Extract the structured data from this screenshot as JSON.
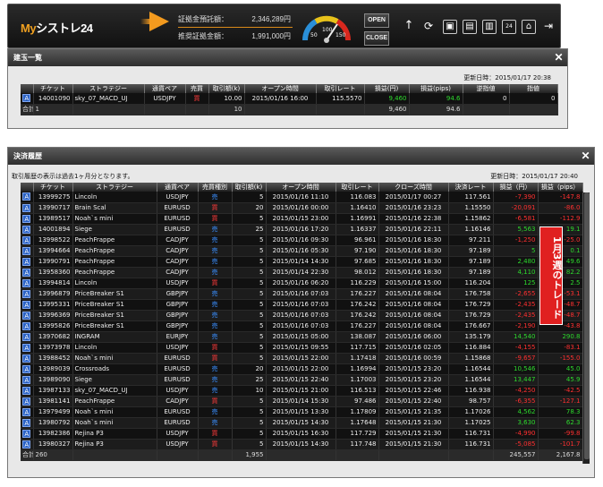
{
  "app": {
    "logo_prefix": "My",
    "logo_name": "シストレ24"
  },
  "account": {
    "margin_label": "証拠金預託額：",
    "margin_value": "2,346,289円",
    "equity_label": "推奨証拠金額：",
    "equity_value": "1,991,000円"
  },
  "gauge": {
    "ticks": [
      "50",
      "100",
      "150"
    ]
  },
  "toolbar": {
    "open_label": "OPEN",
    "close_label": "CLOSE"
  },
  "positions": {
    "title": "建玉一覧",
    "updated": "更新日時：2015/01/17 20:38",
    "headers": [
      "チケット",
      "ストラテジー",
      "通貨ペア",
      "売買",
      "取引額(k)",
      "オープン時間",
      "取引レート",
      "損益(円)",
      "損益(pips)",
      "逆指値",
      "指値"
    ],
    "rows": [
      {
        "icon": "A",
        "ticket": "14001090",
        "strategy": "sky_07_MACD_UJ",
        "pair": "USDJPY",
        "side": "買",
        "amount": "10.00",
        "open": "2015/01/16 16:00",
        "rate": "115.5570",
        "pnl": "9,460",
        "pips": "94.6",
        "stop": "0",
        "limit": "0"
      }
    ],
    "total": {
      "label": "合計",
      "count": "1",
      "amount": "10",
      "pnl": "9,460",
      "pips": "94.6"
    }
  },
  "history": {
    "title": "決済履歴",
    "note": "取引履歴の表示は過去1ヶ月分となります。",
    "updated": "更新日時：2015/01/17 20:40",
    "headers": [
      "チケット",
      "ストラテジー",
      "通貨ペア",
      "売買種別",
      "取引額(k)",
      "オープン時間",
      "取引レート",
      "クローズ時間",
      "決済レート",
      "損益（円）",
      "損益（pips）"
    ],
    "rows": [
      {
        "ticket": "13999275",
        "strategy": "Lincoln",
        "pair": "USDJPY",
        "side": "売",
        "amount": "5",
        "open": "2015/01/16 11:10",
        "rate": "116.083",
        "close": "2015/01/17 00:27",
        "crate": "117.561",
        "pnl": "-7,390",
        "pips": "-147.8"
      },
      {
        "ticket": "13990717",
        "strategy": "Brain Scal",
        "pair": "EURUSD",
        "side": "買",
        "amount": "20",
        "open": "2015/01/16 00:00",
        "rate": "1.16410",
        "close": "2015/01/16 23:23",
        "crate": "1.15550",
        "pnl": "-20,091",
        "pips": "-86.0"
      },
      {
        "ticket": "13989517",
        "strategy": "Noah`s mini",
        "pair": "EURUSD",
        "side": "買",
        "amount": "5",
        "open": "2015/01/15 23:00",
        "rate": "1.16991",
        "close": "2015/01/16 22:38",
        "crate": "1.15862",
        "pnl": "-6,581",
        "pips": "-112.9"
      },
      {
        "ticket": "14001894",
        "strategy": "Siege",
        "pair": "EURUSD",
        "side": "売",
        "amount": "25",
        "open": "2015/01/16 17:20",
        "rate": "1.16337",
        "close": "2015/01/16 22:11",
        "crate": "1.16146",
        "pnl": "5,563",
        "pips": "19.1"
      },
      {
        "ticket": "13998522",
        "strategy": "PeachFrappe",
        "pair": "CADJPY",
        "side": "売",
        "amount": "5",
        "open": "2015/01/16 09:30",
        "rate": "96.961",
        "close": "2015/01/16 18:30",
        "crate": "97.211",
        "pnl": "-1,250",
        "pips": "-25.0"
      },
      {
        "ticket": "13994664",
        "strategy": "PeachFrappe",
        "pair": "CADJPY",
        "side": "売",
        "amount": "5",
        "open": "2015/01/16 05:30",
        "rate": "97.190",
        "close": "2015/01/16 18:30",
        "crate": "97.189",
        "pnl": "5",
        "pips": "0.1"
      },
      {
        "ticket": "13990791",
        "strategy": "PeachFrappe",
        "pair": "CADJPY",
        "side": "売",
        "amount": "5",
        "open": "2015/01/14 14:30",
        "rate": "97.685",
        "close": "2015/01/16 18:30",
        "crate": "97.189",
        "pnl": "2,480",
        "pips": "49.6"
      },
      {
        "ticket": "13958360",
        "strategy": "PeachFrappe",
        "pair": "CADJPY",
        "side": "売",
        "amount": "5",
        "open": "2015/01/14 22:30",
        "rate": "98.012",
        "close": "2015/01/16 18:30",
        "crate": "97.189",
        "pnl": "4,110",
        "pips": "82.2"
      },
      {
        "ticket": "13994814",
        "strategy": "Lincoln",
        "pair": "USDJPY",
        "side": "買",
        "amount": "5",
        "open": "2015/01/16 06:20",
        "rate": "116.229",
        "close": "2015/01/16 15:00",
        "crate": "116.204",
        "pnl": "125",
        "pips": "2.5"
      },
      {
        "ticket": "13996879",
        "strategy": "PriceBreaker S1",
        "pair": "GBPJPY",
        "side": "売",
        "amount": "5",
        "open": "2015/01/16 07:03",
        "rate": "176.227",
        "close": "2015/01/16 08:04",
        "crate": "176.758",
        "pnl": "-2,655",
        "pips": "-53.1"
      },
      {
        "ticket": "13995331",
        "strategy": "PriceBreaker S1",
        "pair": "GBPJPY",
        "side": "売",
        "amount": "5",
        "open": "2015/01/16 07:03",
        "rate": "176.242",
        "close": "2015/01/16 08:04",
        "crate": "176.729",
        "pnl": "-2,435",
        "pips": "-48.7"
      },
      {
        "ticket": "13996369",
        "strategy": "PriceBreaker S1",
        "pair": "GBPJPY",
        "side": "売",
        "amount": "5",
        "open": "2015/01/16 07:03",
        "rate": "176.242",
        "close": "2015/01/16 08:04",
        "crate": "176.729",
        "pnl": "-2,435",
        "pips": "-48.7"
      },
      {
        "ticket": "13995826",
        "strategy": "PriceBreaker S1",
        "pair": "GBPJPY",
        "side": "売",
        "amount": "5",
        "open": "2015/01/16 07:03",
        "rate": "176.227",
        "close": "2015/01/16 08:04",
        "crate": "176.667",
        "pnl": "-2,190",
        "pips": "-43.8"
      },
      {
        "ticket": "13970682",
        "strategy": "INGRAM",
        "pair": "EURJPY",
        "side": "売",
        "amount": "5",
        "open": "2015/01/15 05:00",
        "rate": "138.087",
        "close": "2015/01/16 06:00",
        "crate": "135.179",
        "pnl": "14,540",
        "pips": "290.8"
      },
      {
        "ticket": "13973978",
        "strategy": "Lincoln",
        "pair": "USDJPY",
        "side": "買",
        "amount": "5",
        "open": "2015/01/15 09:55",
        "rate": "117.715",
        "close": "2015/01/16 02:05",
        "crate": "116.884",
        "pnl": "-4,155",
        "pips": "-83.1"
      },
      {
        "ticket": "13988452",
        "strategy": "Noah`s mini",
        "pair": "EURUSD",
        "side": "買",
        "amount": "5",
        "open": "2015/01/15 22:00",
        "rate": "1.17418",
        "close": "2015/01/16 00:59",
        "crate": "1.15868",
        "pnl": "-9,657",
        "pips": "-155.0"
      },
      {
        "ticket": "13989039",
        "strategy": "Crossroads",
        "pair": "EURUSD",
        "side": "売",
        "amount": "20",
        "open": "2015/01/15 22:00",
        "rate": "1.16994",
        "close": "2015/01/15 23:20",
        "crate": "1.16544",
        "pnl": "10,546",
        "pips": "45.0"
      },
      {
        "ticket": "13989090",
        "strategy": "Siege",
        "pair": "EURUSD",
        "side": "売",
        "amount": "25",
        "open": "2015/01/15 22:40",
        "rate": "1.17003",
        "close": "2015/01/15 23:20",
        "crate": "1.16544",
        "pnl": "13,447",
        "pips": "45.9"
      },
      {
        "ticket": "13987133",
        "strategy": "sky_07_MACD_UJ",
        "pair": "USDJPY",
        "side": "売",
        "amount": "10",
        "open": "2015/01/15 21:00",
        "rate": "116.513",
        "close": "2015/01/15 22:46",
        "crate": "116.938",
        "pnl": "-4,250",
        "pips": "-42.5"
      },
      {
        "ticket": "13981141",
        "strategy": "PeachFrappe",
        "pair": "CADJPY",
        "side": "買",
        "amount": "5",
        "open": "2015/01/14 15:30",
        "rate": "97.486",
        "close": "2015/01/15 22:40",
        "crate": "98.757",
        "pnl": "-6,355",
        "pips": "-127.1"
      },
      {
        "ticket": "13979499",
        "strategy": "Noah`s mini",
        "pair": "EURUSD",
        "side": "売",
        "amount": "5",
        "open": "2015/01/15 13:30",
        "rate": "1.17809",
        "close": "2015/01/15 21:35",
        "crate": "1.17026",
        "pnl": "4,562",
        "pips": "78.3"
      },
      {
        "ticket": "13980792",
        "strategy": "Noah`s mini",
        "pair": "EURUSD",
        "side": "売",
        "amount": "5",
        "open": "2015/01/15 14:30",
        "rate": "1.17648",
        "close": "2015/01/15 21:30",
        "crate": "1.17025",
        "pnl": "3,630",
        "pips": "62.3"
      },
      {
        "ticket": "13982386",
        "strategy": "Rejina P3",
        "pair": "USDJPY",
        "side": "買",
        "amount": "5",
        "open": "2015/01/15 16:30",
        "rate": "117.729",
        "close": "2015/01/15 21:30",
        "crate": "116.731",
        "pnl": "-4,990",
        "pips": "-99.8"
      },
      {
        "ticket": "13980327",
        "strategy": "Rejina P3",
        "pair": "USDJPY",
        "side": "買",
        "amount": "5",
        "open": "2015/01/15 14:30",
        "rate": "117.748",
        "close": "2015/01/15 21:30",
        "crate": "116.731",
        "pnl": "-5,085",
        "pips": "-101.7"
      }
    ],
    "total": {
      "label": "合計",
      "count": "260",
      "amount": "1,955",
      "pnl": "245,557",
      "pips": "2,167.8"
    },
    "side_label": "1月3週のトレード"
  }
}
